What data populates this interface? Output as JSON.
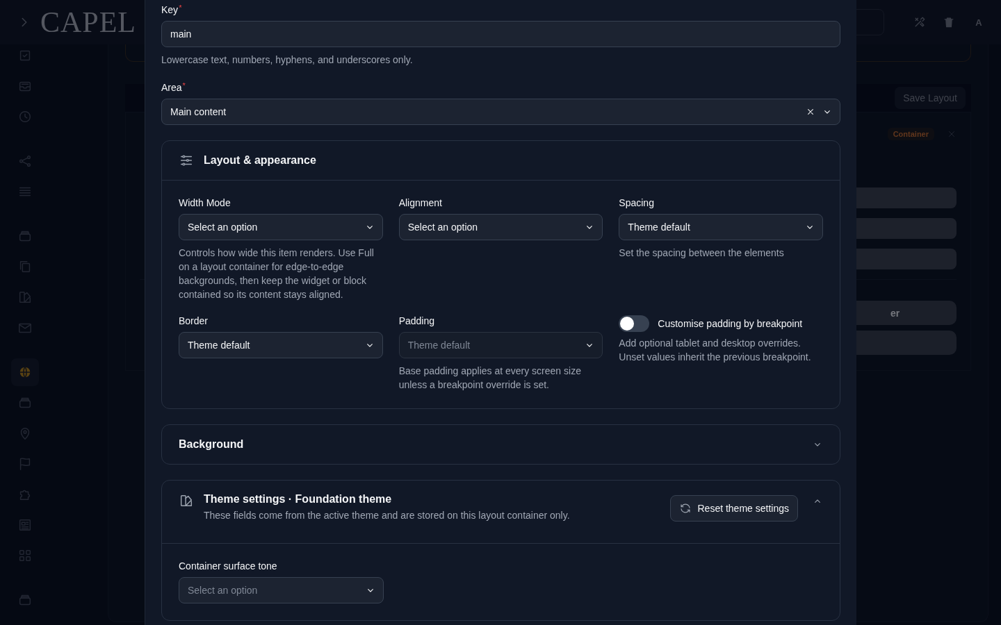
{
  "app_header": {
    "logo": "CAPEL",
    "avatar": "A"
  },
  "sidebar": {
    "groups": [
      [
        {
          "kind": "check",
          "selected": false
        },
        {
          "kind": "inbox",
          "selected": false
        },
        {
          "kind": "clock",
          "selected": false
        }
      ],
      [
        {
          "kind": "share",
          "selected": false
        },
        {
          "kind": "list",
          "selected": false
        }
      ],
      [
        {
          "kind": "archive",
          "selected": false
        },
        {
          "kind": "copy",
          "selected": false
        },
        {
          "kind": "palette",
          "selected": false
        },
        {
          "kind": "mail",
          "selected": false
        }
      ],
      [
        {
          "kind": "globe",
          "selected": true
        },
        {
          "kind": "archive",
          "selected": false
        },
        {
          "kind": "pin",
          "selected": false
        },
        {
          "kind": "flag",
          "selected": false
        },
        {
          "kind": "puzzle",
          "selected": false
        },
        {
          "kind": "news",
          "selected": false
        },
        {
          "kind": "grid",
          "selected": false
        }
      ],
      [
        {
          "kind": "archive",
          "selected": false
        }
      ]
    ]
  },
  "background_page": {
    "save_button": "Save Layout",
    "badge": "Container",
    "button_fragment": "er"
  },
  "modal": {
    "fields": [
      {
        "kind": "text",
        "label": "Key",
        "required_mark": "*",
        "value": "main",
        "help": "Lowercase text, numbers, hyphens, and underscores only."
      },
      {
        "kind": "select",
        "label": "Area",
        "required_mark": "*",
        "value": "Main content",
        "clearable": true
      }
    ],
    "sections": [
      {
        "kind": "settings",
        "title": "Layout & appearance",
        "expanded": true,
        "fields": [
          {
            "kind": "select",
            "label": "Width Mode",
            "value": "Select an option",
            "help": "Controls how wide this item renders. Use Full on a layout container for edge-to-edge backgrounds, then keep the widget or block contained so its content stays aligned."
          },
          {
            "kind": "select",
            "label": "Alignment",
            "value": "Select an option"
          },
          {
            "kind": "select",
            "label": "Spacing",
            "value": "Theme default",
            "help": "Set the spacing between the elements"
          },
          {
            "kind": "select",
            "label": "Border",
            "value": "Theme default"
          },
          {
            "kind": "select",
            "label": "Padding",
            "placeholder": "Theme default",
            "disabled": true,
            "help": "Base padding applies at every screen size unless a breakpoint override is set."
          },
          {
            "kind": "toggle",
            "label": "Customise padding by breakpoint",
            "on": false,
            "help": "Add optional tablet and desktop overrides. Unset values inherit the previous breakpoint."
          }
        ]
      },
      {
        "kind": "plain",
        "title": "Background",
        "expanded": false
      },
      {
        "kind": "theme",
        "title": "Theme settings · Foundation theme",
        "subtitle": "These fields come from the active theme and are stored on this layout container only.",
        "action": "Reset theme settings",
        "expanded": true,
        "fields": [
          {
            "kind": "select",
            "label": "Container surface tone",
            "placeholder": "Select an option"
          }
        ]
      }
    ]
  }
}
